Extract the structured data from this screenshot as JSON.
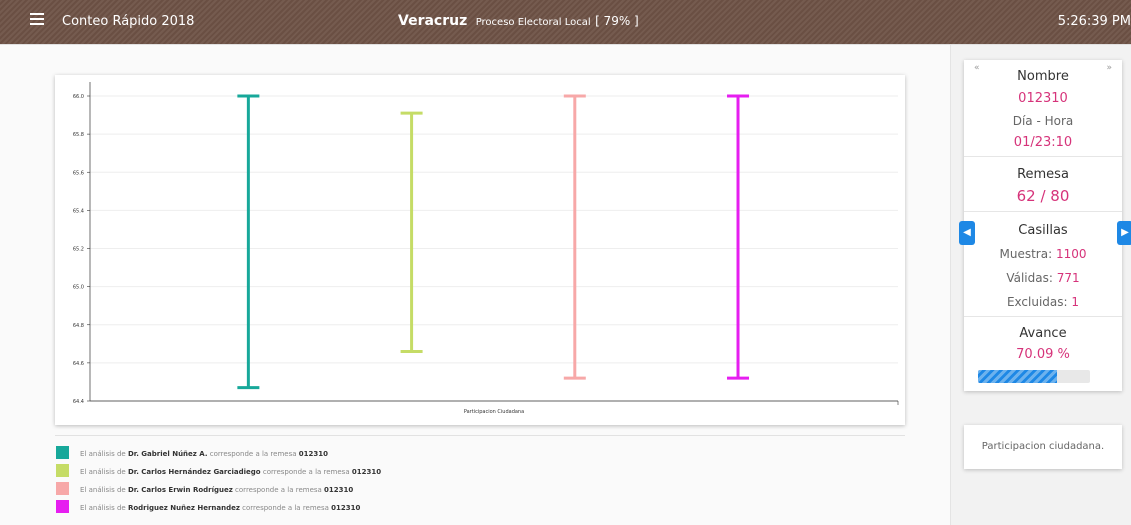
{
  "header": {
    "app_title": "Conteo Rápido 2018",
    "state": "Veracruz",
    "process": "Proceso Electoral Local",
    "percent": "[ 79% ]",
    "clock": "5:26:39 PM"
  },
  "chart_data": {
    "type": "errorbar",
    "title": "",
    "xlabel": "",
    "ylabel": "",
    "categories": [
      "Participacion Ciudadana"
    ],
    "ylim": [
      64.4,
      66.0
    ],
    "yticks": [
      "66.0",
      "65.8",
      "65.6",
      "65.4",
      "65.2",
      "65.0",
      "64.8",
      "64.6",
      "64.4"
    ],
    "series": [
      {
        "name": "Dr. Gabriel Núñez A.",
        "color": "#17a89a",
        "low": 64.47,
        "high": 66.0
      },
      {
        "name": "Dr. Carlos Hernández Garciadiego",
        "color": "#c5dc66",
        "low": 64.66,
        "high": 65.91
      },
      {
        "name": "Dr. Carlos Erwin Rodríguez",
        "color": "#f7a8a8",
        "low": 64.52,
        "high": 66.0
      },
      {
        "name": "Rodriguez Nuñez Hernandez",
        "color": "#e61ef0",
        "low": 64.52,
        "high": 66.0
      }
    ],
    "grid": true,
    "legend": "bottom"
  },
  "legend": {
    "prefix": "El análisis de",
    "middle": "corresponde a la remesa",
    "remesa": "012310",
    "items": [
      {
        "name": "Dr. Gabriel Núñez A.",
        "color": "#17a89a"
      },
      {
        "name": "Dr. Carlos Hernández Garciadiego",
        "color": "#c5dc66"
      },
      {
        "name": "Dr. Carlos Erwin Rodríguez",
        "color": "#f7a8a8"
      },
      {
        "name": "Rodriguez Nuñez Hernandez",
        "color": "#e61ef0"
      }
    ]
  },
  "sidebar": {
    "prev": "«",
    "next": "»",
    "nombre_label": "Nombre",
    "nombre_value": "012310",
    "dia_label": "Día - Hora",
    "dia_value": "01/23:10",
    "remesa_label": "Remesa",
    "remesa_value": "62 / 80",
    "casillas_label": "Casillas",
    "muestra_label": "Muestra:",
    "muestra_value": "1100",
    "validas_label": "Válidas:",
    "validas_value": "771",
    "excluidas_label": "Excluidas:",
    "excluidas_value": "1",
    "avance_label": "Avance",
    "avance_value": "70.09 %",
    "avance_fraction": 0.7009,
    "note": "Participacion ciudadana."
  }
}
